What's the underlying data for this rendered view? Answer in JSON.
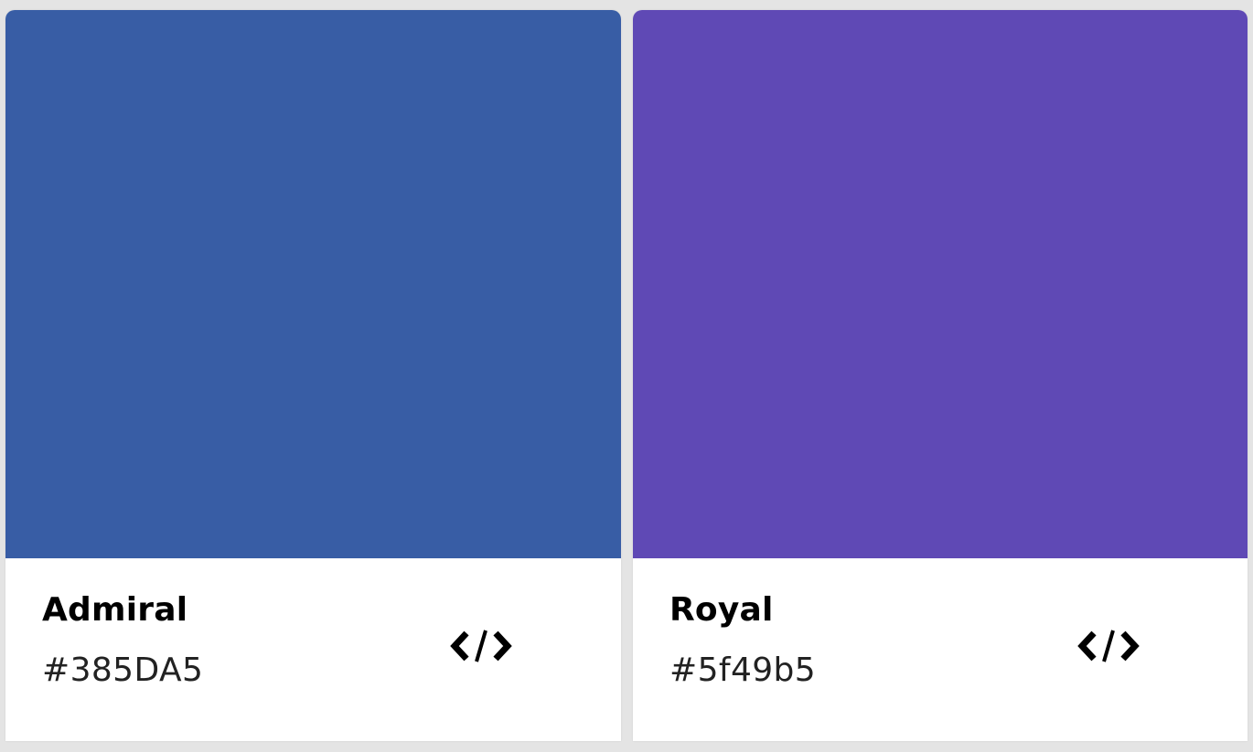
{
  "colors": [
    {
      "name": "Admiral",
      "hex_label": "#385DA5",
      "swatch_color": "#385DA5",
      "action_icon": "code-icon"
    },
    {
      "name": "Royal",
      "hex_label": "#5f49b5",
      "swatch_color": "#5f49b5",
      "action_icon": "code-icon"
    }
  ]
}
